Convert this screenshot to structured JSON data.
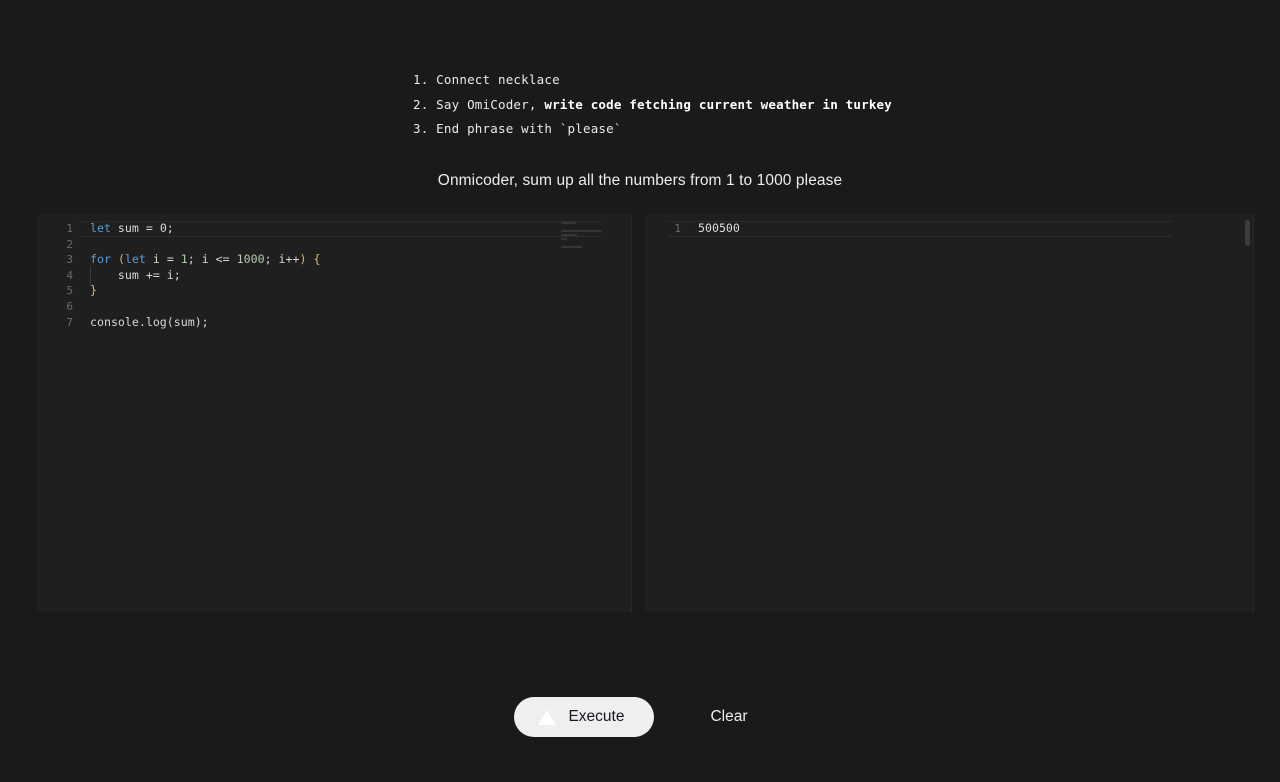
{
  "instructions": [
    {
      "number": "1.",
      "text": "Connect necklace",
      "bold": ""
    },
    {
      "number": "2.",
      "text": "Say OmiCoder, ",
      "bold": "write code fetching current weather in turkey"
    },
    {
      "number": "3.",
      "text": "End phrase with `please`",
      "bold": ""
    }
  ],
  "prompt": {
    "text": "Onmicoder, sum up all the numbers from 1 to 1000 please"
  },
  "editor": {
    "lines": [
      {
        "number": "1",
        "tokens": [
          {
            "t": "let",
            "c": "kw"
          },
          {
            "t": " sum = 0;",
            "c": "def"
          }
        ]
      },
      {
        "number": "2",
        "tokens": []
      },
      {
        "number": "3",
        "tokens": [
          {
            "t": "for",
            "c": "kw"
          },
          {
            "t": " ",
            "c": "def"
          },
          {
            "t": "(",
            "c": "par"
          },
          {
            "t": "let",
            "c": "kw"
          },
          {
            "t": " i = ",
            "c": "def"
          },
          {
            "t": "1",
            "c": "num"
          },
          {
            "t": "; i <= ",
            "c": "def"
          },
          {
            "t": "1000",
            "c": "num"
          },
          {
            "t": "; i++",
            "c": "def"
          },
          {
            "t": ")",
            "c": "par"
          },
          {
            "t": " ",
            "c": "def"
          },
          {
            "t": "{",
            "c": "brc"
          }
        ]
      },
      {
        "number": "4",
        "tokens": [
          {
            "t": "    sum += i;",
            "c": "def"
          }
        ]
      },
      {
        "number": "5",
        "tokens": [
          {
            "t": "}",
            "c": "brc"
          }
        ]
      },
      {
        "number": "6",
        "tokens": []
      },
      {
        "number": "7",
        "tokens": [
          {
            "t": "console.log(sum);",
            "c": "def"
          }
        ]
      }
    ]
  },
  "output": {
    "lines": [
      {
        "number": "1",
        "text": "500500"
      }
    ]
  },
  "buttons": {
    "execute_label": "Execute",
    "execute_icon": "play-triangle-icon",
    "clear_label": "Clear"
  },
  "colors": {
    "page_background": "#1b1a1a",
    "pane_background": "#201f1f",
    "keyword": "#569cd6",
    "number": "#b5cea8",
    "bracket": "#d8b96a",
    "text": "#d6d6d6",
    "execute_button": "#efefef"
  }
}
